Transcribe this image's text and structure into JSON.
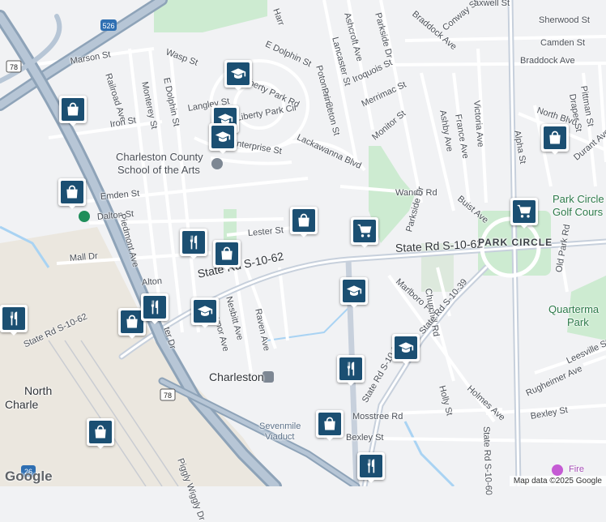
{
  "streets": {
    "marson": "Marson St",
    "wasp": "Wasp St",
    "e_dolphin": "E Dolphin St",
    "e_dolphin_v": "E Dolphin St",
    "monterey": "Monterey St",
    "railroad": "Railroad Ave",
    "iron": "Iron St",
    "langley": "Langley St",
    "liberty_park_rd": "Liberty Park Rd",
    "liberty_park_cir": "Liberty Park Cir",
    "enterprise": "Enterprise St",
    "lackawanna": "Lackawanna Blvd",
    "emden": "Emden St",
    "dalton": "Dalton St",
    "piedmont": "Piedmont Ave",
    "mall": "Mall Dr",
    "alton": "Alton",
    "lester": "Lester St",
    "state_rd_1062_a": "State Rd S-10-62",
    "state_rd_1062_b": "State Rd S-10-62",
    "state_rd_1062_c": "State Rd S-10-62",
    "nesbitt": "Nesbitt Ave",
    "gaynor": "Gaynor Ave",
    "raven": "Raven Ave",
    "pier": "ter Dr",
    "ashcroft": "Ashcroft Ave",
    "lancaster": "Lancaster St",
    "parkside_n": "Parkside Dr",
    "parkside_s": "Parkside Dr",
    "braddock_n": "Braddock Ave",
    "braddock": "Braddock Ave",
    "potomac": "Potomac St",
    "princeton": "Princeton St",
    "iroquois": "Iroquois St",
    "merrimac": "Merrimac St",
    "monitor": "Monitor St",
    "wando": "Wando Rd",
    "buist": "Buist Ave",
    "ashby": "Ashby Ave",
    "france": "France Ave",
    "victoria": "Victoria Ave",
    "conway": "Conway St",
    "sherwood": "Sherwood St",
    "camden": "Camden St",
    "north_blvd": "North Blvd",
    "alpha": "Alpha St",
    "draper": "Draper St",
    "pittman": "Pittman St",
    "durant": "Durant Ave",
    "old_park": "Old Park Rd",
    "marlboro": "Marlboro Pl",
    "churchill": "Churchill Rd",
    "state_rd_1039": "State Rd S-10-39",
    "state_rd_103x": "State Rd S-10-3",
    "state_rd_1060": "State Rd S-10-60",
    "holly": "Holly St",
    "holmes": "Holmes Ave",
    "rugheimer": "Rugheimer Ave",
    "leesville": "Leesville St",
    "bexley_e": "Bexley St",
    "bexley_w": "Bexley St",
    "mosstree": "Mosstree Rd",
    "piggly": "Piggly Wiggly Dr",
    "harr": "Harr",
    "maxwell": "axwell St"
  },
  "places": {
    "school_line1": "Charleston County",
    "school_line2": "School of the Arts",
    "park_circle": "PARK CIRCLE",
    "park_circle_golf": "Park Circle",
    "park_circle_golf2": "Golf Cours",
    "quartermaster1": "Quarterma",
    "quartermaster2": "Park",
    "charleston": "Charleston",
    "north_charleston1": "North",
    "north_charleston2": "Charle",
    "sevenmile1": "Sevenmile",
    "sevenmile2": "Viaduct",
    "fire": "Fire"
  },
  "shields": {
    "i526": "526",
    "us78_a": "78",
    "us78_b": "78",
    "i26": "26"
  },
  "colors": {
    "pin_fill": "#1b4f72",
    "road_major": "#8ea3b8",
    "park_green": "#cdebd1",
    "water": "#a9d3f3"
  },
  "poi_pins": [
    {
      "kind": "school-icon",
      "name": "school"
    },
    {
      "kind": "school-icon",
      "name": "school"
    },
    {
      "kind": "school-icon",
      "name": "school"
    },
    {
      "kind": "school-icon",
      "name": "school"
    },
    {
      "kind": "school-icon",
      "name": "school"
    },
    {
      "kind": "school-icon",
      "name": "school"
    },
    {
      "kind": "shopping-bag-icon",
      "name": "shop"
    },
    {
      "kind": "shopping-bag-icon",
      "name": "shop"
    },
    {
      "kind": "shopping-bag-icon",
      "name": "shop"
    },
    {
      "kind": "shopping-bag-icon",
      "name": "shop"
    },
    {
      "kind": "shopping-bag-icon",
      "name": "shop"
    },
    {
      "kind": "shopping-bag-icon",
      "name": "shop"
    },
    {
      "kind": "shopping-bag-icon",
      "name": "shop"
    },
    {
      "kind": "shopping-bag-icon",
      "name": "shop"
    },
    {
      "kind": "restaurant-icon",
      "name": "restaurant"
    },
    {
      "kind": "restaurant-icon",
      "name": "restaurant"
    },
    {
      "kind": "restaurant-icon",
      "name": "restaurant"
    },
    {
      "kind": "restaurant-icon",
      "name": "restaurant"
    },
    {
      "kind": "restaurant-icon",
      "name": "restaurant"
    },
    {
      "kind": "grocery-cart-icon",
      "name": "grocery"
    },
    {
      "kind": "grocery-cart-icon",
      "name": "grocery"
    }
  ],
  "footer": {
    "attribution": "Map data ©2025 Google",
    "logo": "Google"
  }
}
